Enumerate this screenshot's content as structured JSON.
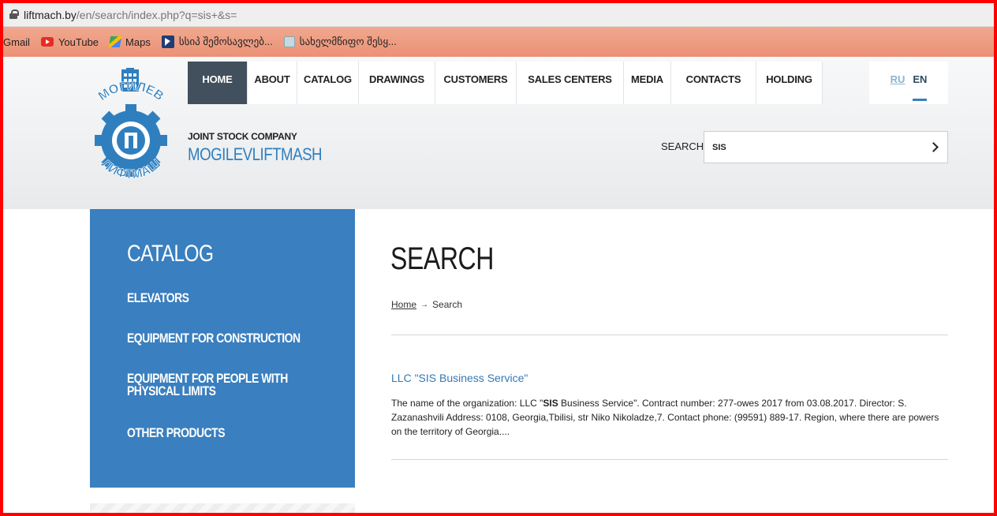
{
  "browser": {
    "address_host": "liftmach.by",
    "address_rest": "/en/search/index.php?q=sis+&s=",
    "bookmarks": [
      {
        "label": "Gmail",
        "icon": "gmail-icon"
      },
      {
        "label": "YouTube",
        "icon": "youtube-icon"
      },
      {
        "label": "Maps",
        "icon": "maps-icon"
      },
      {
        "label": "სსიპ შემოსავლებ...",
        "icon": "cursor-icon"
      },
      {
        "label": "სახელმწიფო შესყ...",
        "icon": "gov-icon"
      }
    ]
  },
  "nav": {
    "items": [
      {
        "label": "HOME",
        "active": true
      },
      {
        "label": "ABOUT"
      },
      {
        "label": "CATALOG"
      },
      {
        "label": "DRAWINGS"
      },
      {
        "label": "CUSTOMERS"
      },
      {
        "label": "SALES CENTERS"
      },
      {
        "label": "MEDIA"
      },
      {
        "label": "CONTACTS"
      },
      {
        "label": "HOLDING"
      }
    ],
    "lang_ru": "RU",
    "lang_en": "EN"
  },
  "company": {
    "subtitle": "JOINT STOCK COMPANY",
    "name": "MOGILEVLIFTMASH",
    "logo_text_top": "МОГИЛЕВ",
    "logo_text_bottom": "ЛИФТМАШ"
  },
  "search": {
    "label": "SEARCH",
    "value": "SIS"
  },
  "sidebar": {
    "title": "CATALOG",
    "items": [
      {
        "label": "ELEVATORS"
      },
      {
        "label": "EQUIPMENT FOR CONSTRUCTION"
      },
      {
        "label": "EQUIPMENT FOR PEOPLE WITH PHYSICAL LIMITS"
      },
      {
        "label": "OTHER PRODUCTS"
      }
    ]
  },
  "main": {
    "title": "SEARCH",
    "breadcrumb_home": "Home",
    "breadcrumb_sep": "→",
    "breadcrumb_current": "Search",
    "result": {
      "title": "LLC \"SIS Business Service\"",
      "text_before": "The name of the organization: LLC \"",
      "text_bold": "SIS",
      "text_after": " Business Service\". Contract number: 277-owes 2017 from 03.08.2017. Director: S. Zazanashvili Address: 0108, Georgia,Tbilisi, str Niko Nikoladze,7. Contact phone: (99591) 889-17. Region, where there are powers on the territory of Georgia...."
    }
  },
  "colors": {
    "accent_blue": "#3a7fbf",
    "nav_active": "#41505c",
    "bookmarks_bar": "#eb9176",
    "frame_red": "#ff0000"
  }
}
